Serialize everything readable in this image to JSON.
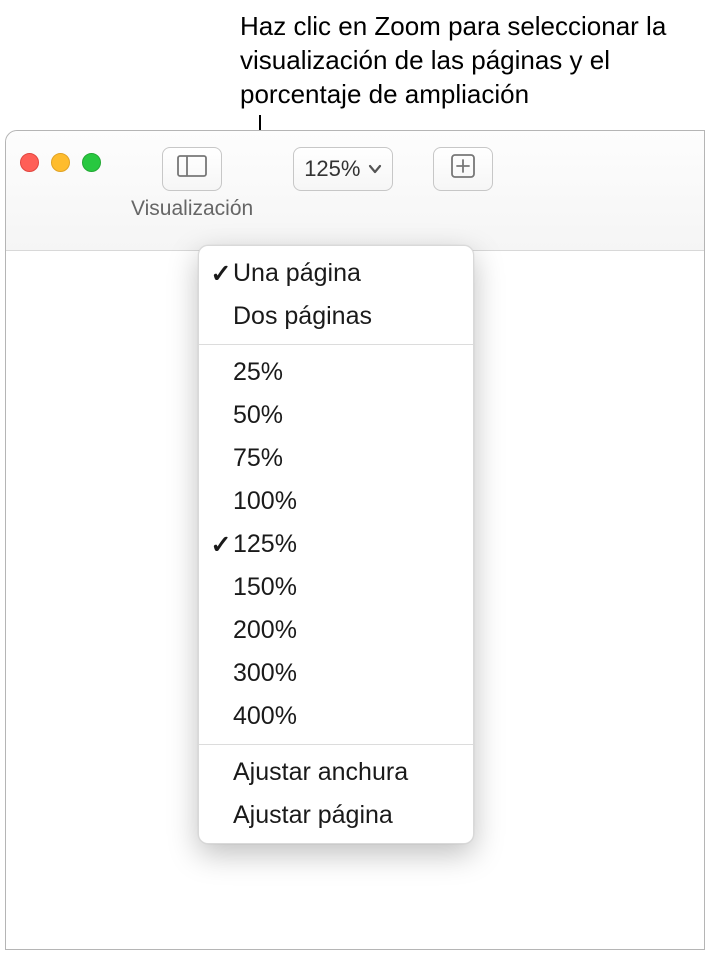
{
  "annotation": {
    "text": "Haz clic en Zoom para seleccionar la visualización de las páginas y el porcentaje de ampliación"
  },
  "toolbar": {
    "view_label": "Visualización",
    "zoom_value": "125%"
  },
  "menu": {
    "page_views": [
      {
        "label": "Una página",
        "checked": true
      },
      {
        "label": "Dos páginas",
        "checked": false
      }
    ],
    "zoom_levels": [
      {
        "label": "25%",
        "checked": false
      },
      {
        "label": "50%",
        "checked": false
      },
      {
        "label": "75%",
        "checked": false
      },
      {
        "label": "100%",
        "checked": false
      },
      {
        "label": "125%",
        "checked": true
      },
      {
        "label": "150%",
        "checked": false
      },
      {
        "label": "200%",
        "checked": false
      },
      {
        "label": "300%",
        "checked": false
      },
      {
        "label": "400%",
        "checked": false
      }
    ],
    "fit_options": [
      {
        "label": "Ajustar anchura",
        "checked": false
      },
      {
        "label": "Ajustar página",
        "checked": false
      }
    ]
  }
}
